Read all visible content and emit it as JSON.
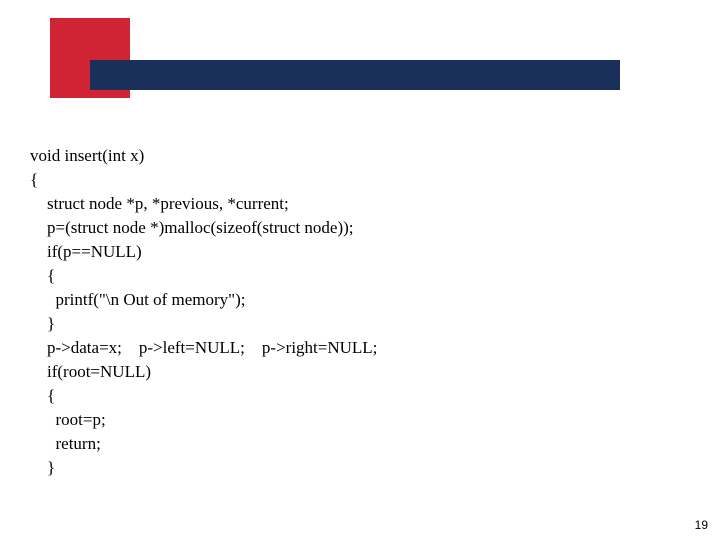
{
  "code": {
    "l1": "void insert(int x)",
    "l2": "{",
    "l3": "    struct node *p, *previous, *current;",
    "l4": "    p=(struct node *)malloc(sizeof(struct node));",
    "l5": "    if(p==NULL)",
    "l6": "    {",
    "l7": "      printf(\"\\n Out of memory\");",
    "l8": "    }",
    "l9": "    p->data=x;    p->left=NULL;    p->right=NULL;",
    "l10": "    if(root=NULL)",
    "l11": "    {",
    "l12": "      root=p;",
    "l13": "      return;",
    "l14": "    }"
  },
  "page_number": "19"
}
